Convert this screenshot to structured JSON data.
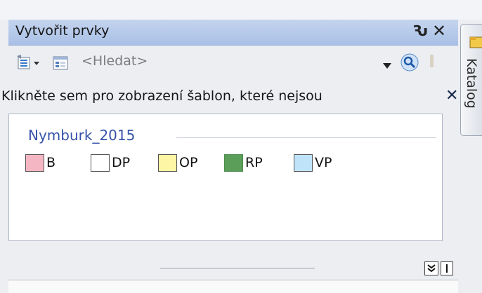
{
  "window": {
    "title": "Vytvořit prvky",
    "pin_glyph": "Ԅ",
    "close_glyph": "✕"
  },
  "toolbar": {
    "search_placeholder": "<Hledat>",
    "icons": [
      "organize-templates-icon",
      "view-templates-icon",
      "dropdown-arrow-icon",
      "search-icon",
      "cut-tool-icon"
    ]
  },
  "notice": {
    "text": "Klikněte sem pro zobrazení šablon, které nejsou",
    "close": "✕",
    "dot": "."
  },
  "templates": {
    "group": "Nymburk_2015",
    "items": [
      {
        "label": "B",
        "color": "#f4b6c2"
      },
      {
        "label": "DP",
        "color": "#ffffff"
      },
      {
        "label": "OP",
        "color": "#fdf6a4"
      },
      {
        "label": "RP",
        "color": "#5a9e5a"
      },
      {
        "label": "VP",
        "color": "#bfe3f9"
      }
    ]
  },
  "side_tab": {
    "label": "Katalog"
  },
  "colors": {
    "title_bar": "#b6cae9",
    "group_label": "#3552a8",
    "panel_bg": "#eceef2"
  }
}
